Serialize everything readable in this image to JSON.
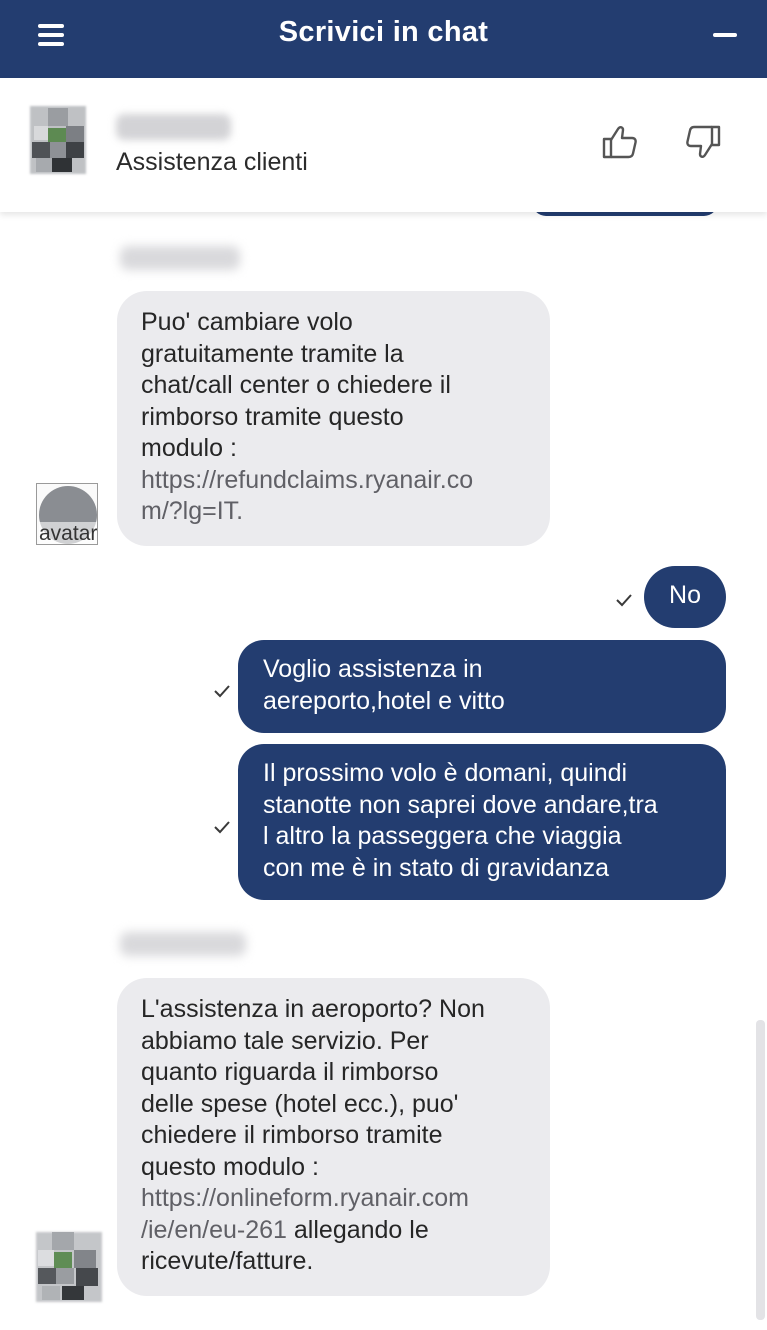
{
  "header": {
    "title": "Scrivici in chat"
  },
  "agent": {
    "role": "Assistenza clienti"
  },
  "messages": {
    "m1": {
      "line1": "Puo' cambiare volo",
      "line2": "gratuitamente tramite la",
      "line3": "chat/call center o chiedere il",
      "line4": "rimborso tramite questo",
      "line5": "modulo :",
      "link1": "https://refundclaims.ryanair.co",
      "link2": "m/?lg=IT."
    },
    "avatar_alt": "avatar",
    "u1": {
      "text": "No"
    },
    "u2": {
      "line1": "Voglio assistenza in",
      "line2": "aereporto,hotel e vitto"
    },
    "u3": {
      "line1": "Il prossimo volo è domani, quindi",
      "line2": "stanotte non saprei dove andare,tra",
      "line3": "l altro la passeggera che viaggia",
      "line4": "con me è in stato di gravidanza"
    },
    "m2": {
      "line1": "L'assistenza in aeroporto? Non",
      "line2": "abbiamo tale servizio. Per",
      "line3": "quanto riguarda il rimborso",
      "line4": "delle spese (hotel ecc.), puo'",
      "line5": "chiedere il rimborso tramite",
      "line6": "questo modulo :",
      "link1": "https://onlineform.ryanair.com",
      "link2": "/ie/en/eu-261",
      "after_link": " allegando le",
      "line9": "ricevute/fatture."
    }
  },
  "icons": {
    "menu": "hamburger-menu-icon",
    "minimize": "minimize-icon",
    "like": "thumbs-up-icon",
    "dislike": "thumbs-down-icon",
    "sent": "checkmark-icon"
  },
  "colors": {
    "brand": "#233d70",
    "agent_bubble": "#ebebee",
    "link": "#606066"
  }
}
